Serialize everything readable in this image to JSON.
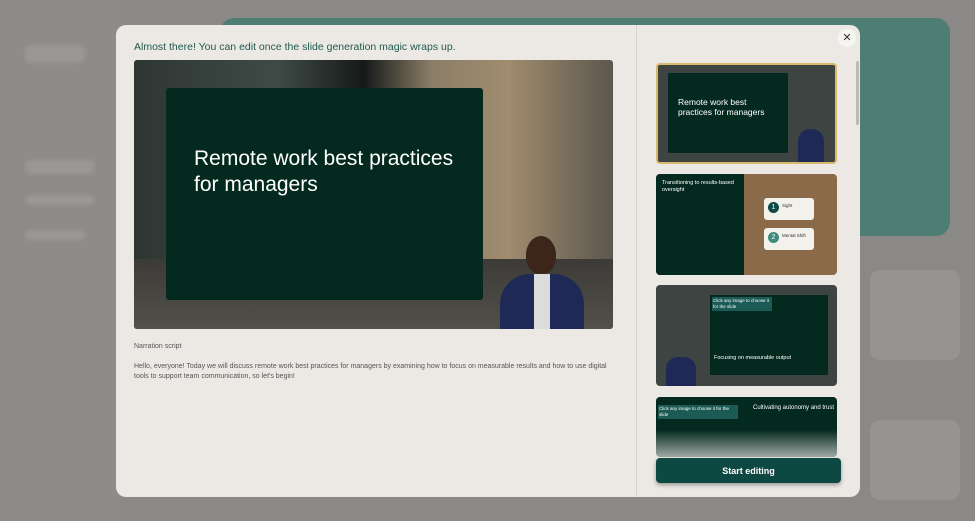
{
  "modal": {
    "title": "Almost there! You can edit once the slide generation magic wraps up.",
    "close_icon": "close-icon",
    "preview": {
      "slide_title": "Remote work best practices for managers"
    },
    "narration_label": "Narration script",
    "narration_text": "Hello, everyone! Today we will discuss remote work best practices for managers by examining how to focus on measurable results and how to use digital tools to support team communication, so let's begin!",
    "thumbnails": [
      {
        "title": "Remote work best practices for managers"
      },
      {
        "title": "Transitioning to results-based oversight",
        "items": [
          {
            "num": "1",
            "label": "Sight"
          },
          {
            "num": "2",
            "label": "Mental Shift"
          }
        ]
      },
      {
        "title": "Focusing on measurable output",
        "hint": "Click any image to choose it for the slide"
      },
      {
        "title": "Cultivating autonomy and trust",
        "hint": "Click any image to choose it for the slide"
      }
    ],
    "start_button": "Start editing"
  },
  "colors": {
    "accent": "#0e4842",
    "slide_bg": "#04291f",
    "selected_border": "#d8b86a"
  }
}
